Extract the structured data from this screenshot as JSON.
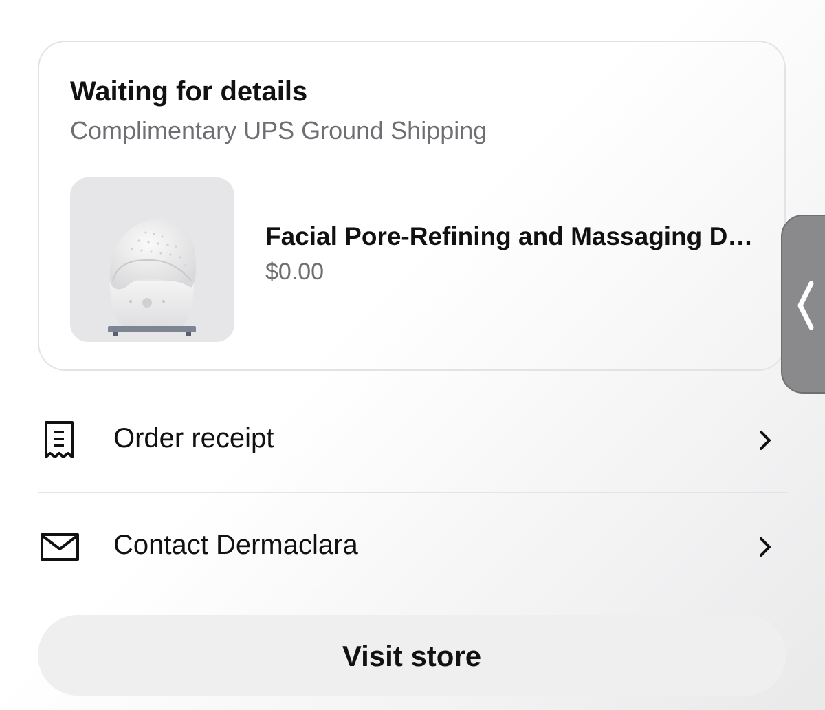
{
  "order": {
    "status_title": "Waiting for details",
    "shipping_method": "Complimentary UPS Ground Shipping",
    "product": {
      "name": "Facial Pore-Refining and Massaging D…",
      "price": "$0.00",
      "image_icon": "facial-cleansing-device-image"
    }
  },
  "actions": {
    "receipt": {
      "label": "Order receipt",
      "icon": "receipt-icon"
    },
    "contact": {
      "label": "Contact Dermaclara",
      "icon": "mail-icon"
    }
  },
  "visit_store_label": "Visit store",
  "side_tab": {
    "icon": "chevron-left-icon"
  },
  "colors": {
    "text_primary": "#111111",
    "text_secondary": "#6e6e73",
    "card_border": "#e3e3e5",
    "button_bg": "#efeff0",
    "side_tab": "#8a8a8c"
  }
}
